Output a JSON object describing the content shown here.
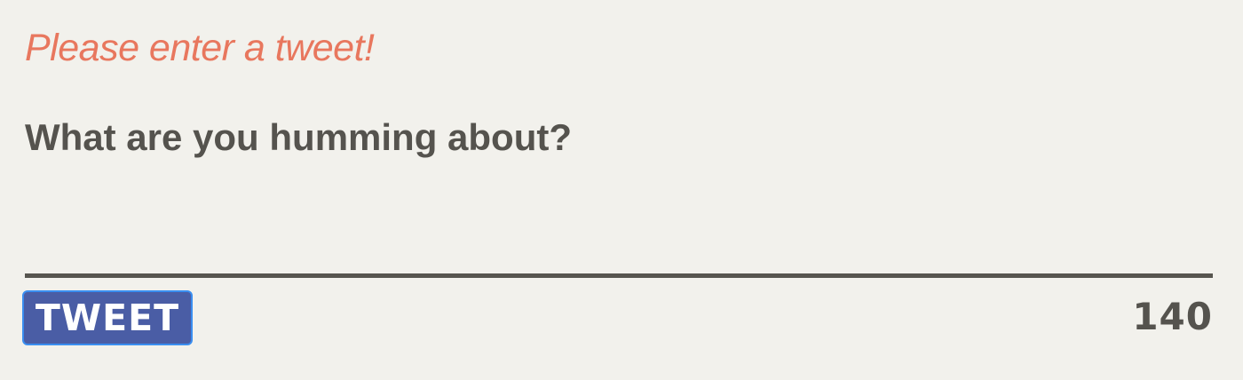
{
  "form": {
    "error_message": "Please enter a tweet!",
    "composer_placeholder": "What are you humming about?",
    "composer_value": "",
    "tweet_button_label": "TWEET",
    "char_count": "140"
  },
  "colors": {
    "background": "#f2f1ec",
    "error": "#e8775e",
    "text": "#55534e",
    "divider": "#57554f",
    "button_bg": "#4a5da5",
    "button_focus_border": "#3a8ef0"
  }
}
